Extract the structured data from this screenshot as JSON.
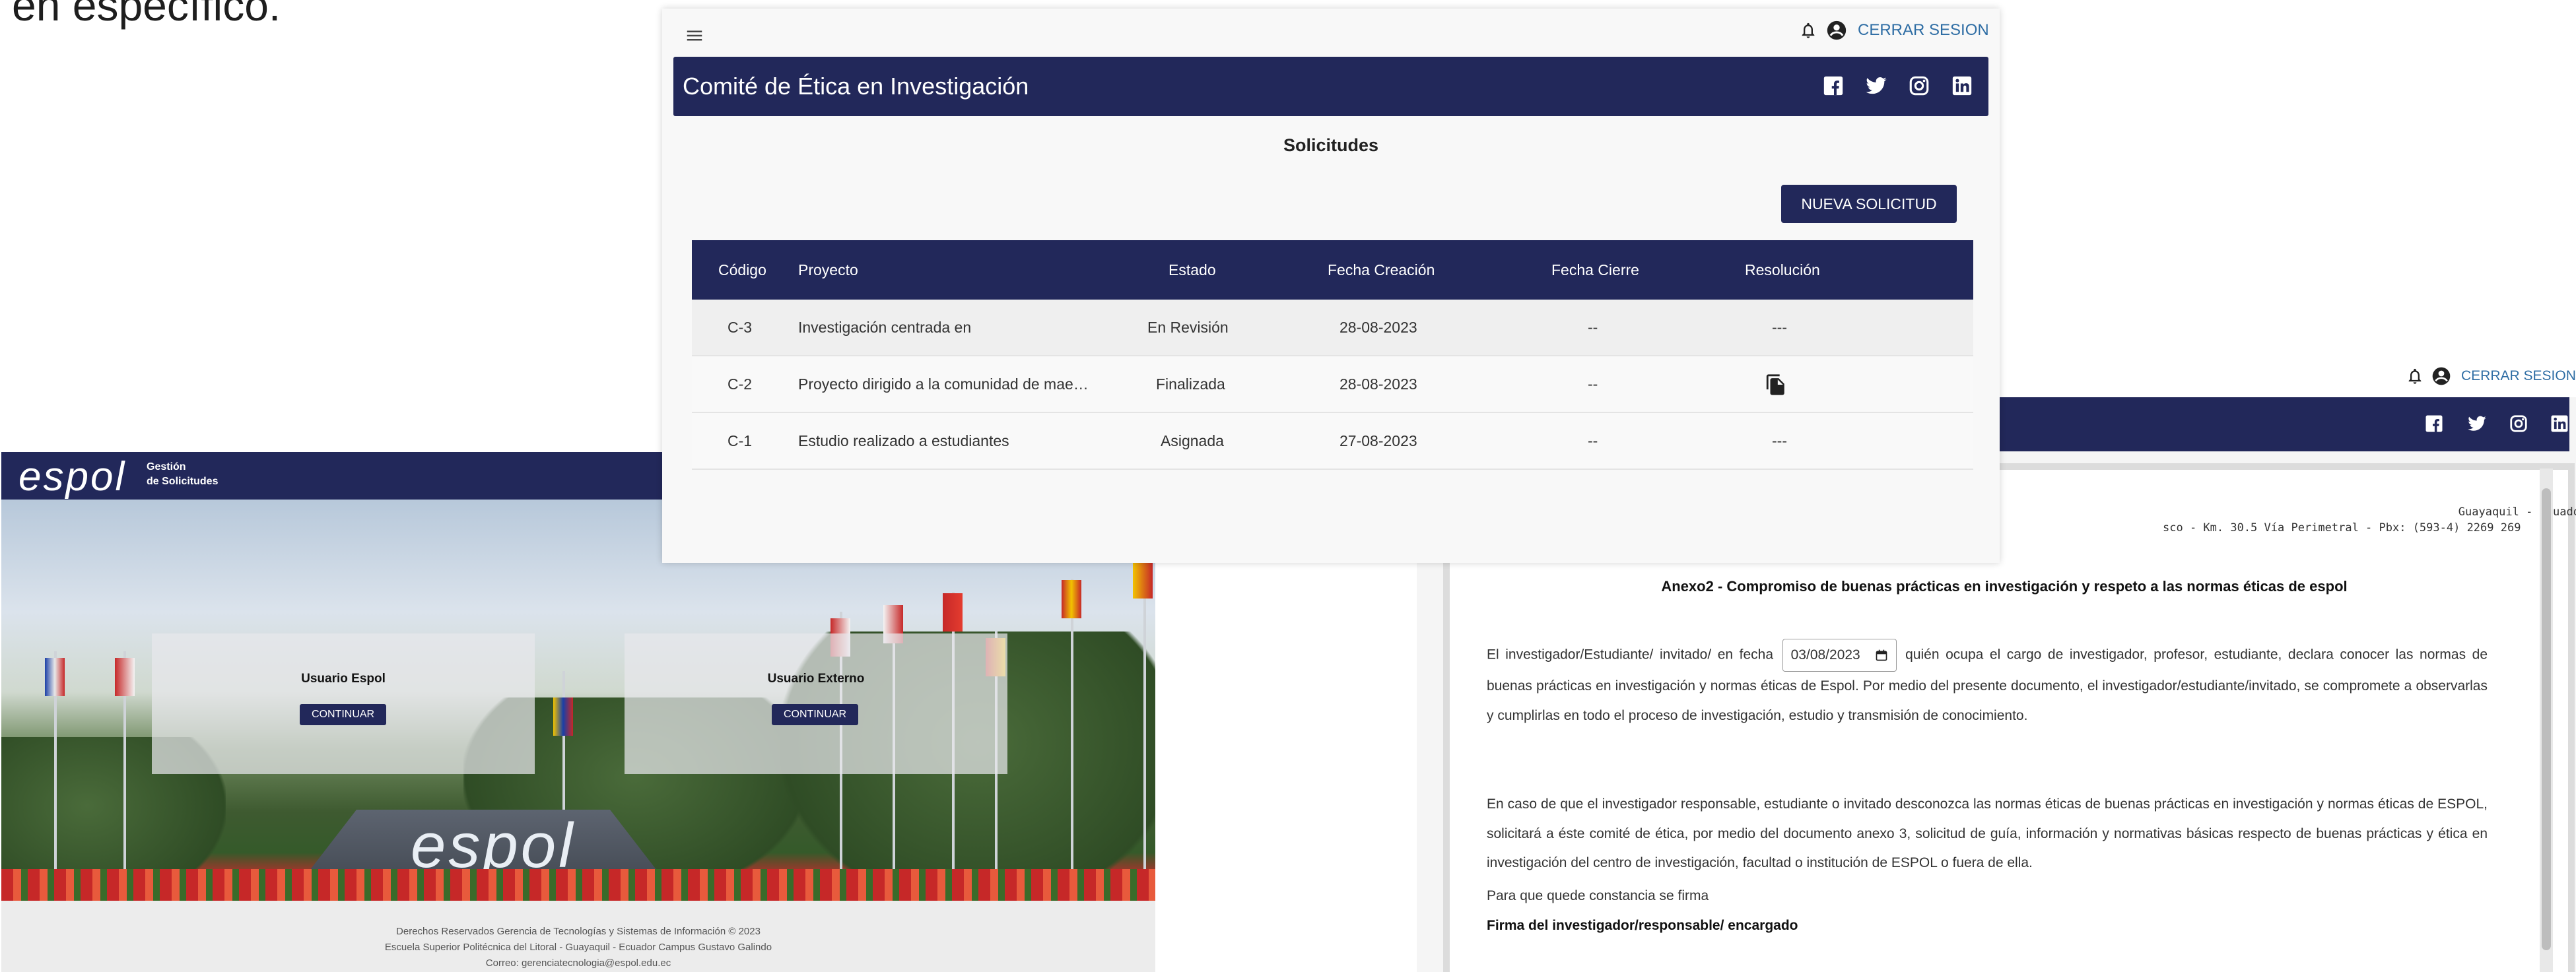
{
  "fragment_text": "en específico.",
  "login_window": {
    "logo": "espol",
    "bar_subtitle_line1": "Gestión",
    "bar_subtitle_line2": "de Solicitudes",
    "monument_text": "espol",
    "cards": [
      {
        "title": "Usuario Espol",
        "button": "CONTINUAR"
      },
      {
        "title": "Usuario Externo",
        "button": "CONTINUAR"
      }
    ],
    "footer": [
      "Derechos Reservados Gerencia de Tecnologías y Sistemas de Información © 2023",
      "Escuela Superior Politécnica del Litoral - Guayaquil - Ecuador Campus Gustavo Galindo",
      "Correo: gerenciatecnologia@espol.edu.ec"
    ]
  },
  "doc_window": {
    "logout_label": "CERRAR SESION",
    "address_line1": "Guayaquil - Ecuador",
    "address_line2": "sco - Km. 30.5 Vía Perimetral - Pbx: (593-4) 2269 269",
    "title": "Anexo2 - Compromiso de buenas prácticas en investigación y respeto a las normas éticas de espol",
    "para1_before_date": "El investigador/Estudiante/ invitado/ en fecha",
    "date_value": "03/08/2023",
    "para1_after_date": "quién ocupa el cargo de investigador, profesor, estudiante, declara conocer las normas de buenas prácticas en investigación y normas éticas de Espol. Por medio del presente documento, el investigador/estudiante/invitado, se compromete a observarlas y cumplirlas en todo el proceso de investigación, estudio y transmisión de conocimiento.",
    "para2": "En caso de que el investigador responsable, estudiante o invitado desconozca las normas éticas de buenas prácticas en investigación y normas éticas de ESPOL, solicitará a éste comité de ética, por medio del documento anexo 3, solicitud de guía, información y normativas básicas respecto de buenas prácticas y ética en investigación del centro de investigación, facultad o institución de ESPOL o fuera de ella.",
    "para3": "Para que quede constancia se firma",
    "signature_label": "Firma del investigador/responsable/ encargado"
  },
  "sol_window": {
    "logout_label": "CERRAR SESION",
    "nav_title": "Comité de Ética en Investigación",
    "page_title": "Solicitudes",
    "new_button": "NUEVA SOLICITUD",
    "columns": [
      "Código",
      "Proyecto",
      "Estado",
      "Fecha Creación",
      "Fecha Cierre",
      "Resolución"
    ],
    "rows": [
      {
        "codigo": "C-3",
        "proyecto": "Investigación centrada en",
        "estado": "En Revisión",
        "fecha_creacion": "28-08-2023",
        "fecha_cierre": "--",
        "resolucion": "---"
      },
      {
        "codigo": "C-2",
        "proyecto": "Proyecto dirigido a la comunidad de mae…",
        "estado": "Finalizada",
        "fecha_creacion": "28-08-2023",
        "fecha_cierre": "--",
        "resolucion": ""
      },
      {
        "codigo": "C-1",
        "proyecto": "Estudio realizado a estudiantes",
        "estado": "Asignada",
        "fecha_creacion": "27-08-2023",
        "fecha_cierre": "--",
        "resolucion": "---"
      }
    ]
  },
  "colors": {
    "navy": "#22285a",
    "link_blue": "#2e6da4"
  },
  "icons": [
    "menu-icon",
    "bell-icon",
    "account-circle-icon",
    "facebook-icon",
    "twitter-icon",
    "instagram-icon",
    "linkedin-icon",
    "document-copy-icon"
  ]
}
